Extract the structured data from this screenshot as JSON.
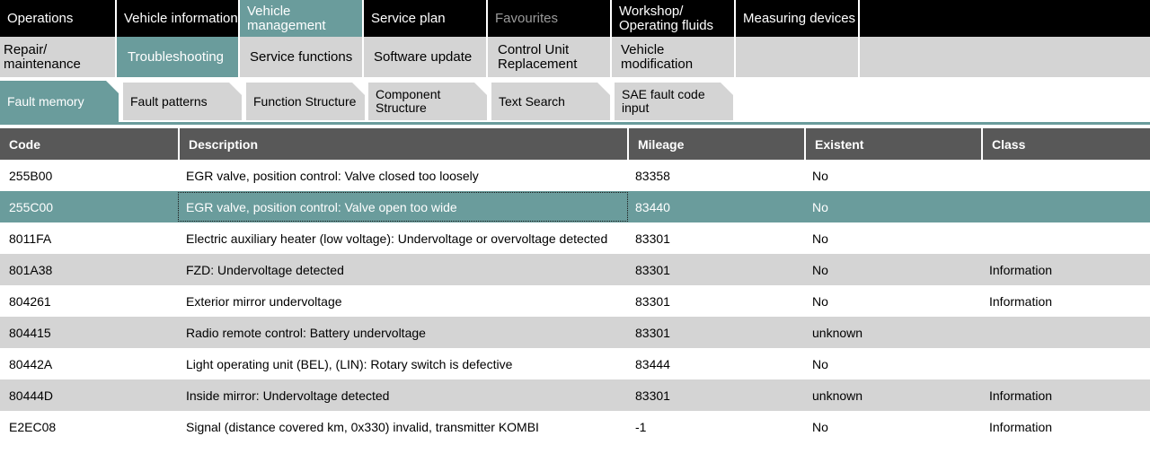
{
  "main_tabs": [
    {
      "label": "Operations",
      "state": "normal"
    },
    {
      "label": "Vehicle information",
      "state": "normal"
    },
    {
      "label": "Vehicle management",
      "state": "active"
    },
    {
      "label": "Service plan",
      "state": "normal"
    },
    {
      "label": "Favourites",
      "state": "disabled"
    },
    {
      "label": "Workshop/ Operating fluids",
      "state": "normal"
    },
    {
      "label": "Measuring devices",
      "state": "normal"
    }
  ],
  "sub_tabs": [
    {
      "label": "Repair/ maintenance",
      "state": "normal"
    },
    {
      "label": "Troubleshooting",
      "state": "active"
    },
    {
      "label": "Service functions",
      "state": "normal"
    },
    {
      "label": "Software update",
      "state": "normal"
    },
    {
      "label": "Control Unit Replacement",
      "state": "normal"
    },
    {
      "label": "Vehicle modification",
      "state": "normal"
    }
  ],
  "function_tabs": [
    {
      "label": "Fault memory",
      "state": "active"
    },
    {
      "label": "Fault patterns",
      "state": "normal"
    },
    {
      "label": "Function Structure",
      "state": "normal"
    },
    {
      "label": "Component Structure",
      "state": "normal"
    },
    {
      "label": "Text Search",
      "state": "normal"
    },
    {
      "label": "SAE fault code input",
      "state": "normal"
    }
  ],
  "table": {
    "headers": {
      "code": "Code",
      "description": "Description",
      "mileage": "Mileage",
      "existent": "Existent",
      "class": "Class"
    },
    "rows": [
      {
        "code": "255B00",
        "description": "EGR valve, position control: Valve closed too loosely",
        "mileage": "83358",
        "existent": "No",
        "class": ""
      },
      {
        "code": "255C00",
        "description": "EGR valve, position control: Valve open too wide",
        "mileage": "83440",
        "existent": "No",
        "class": ""
      },
      {
        "code": "8011FA",
        "description": "Electric auxiliary heater (low voltage): Undervoltage or overvoltage detected",
        "mileage": "83301",
        "existent": "No",
        "class": ""
      },
      {
        "code": "801A38",
        "description": "FZD: Undervoltage detected",
        "mileage": "83301",
        "existent": "No",
        "class": "Information"
      },
      {
        "code": "804261",
        "description": "Exterior mirror undervoltage",
        "mileage": "83301",
        "existent": "No",
        "class": "Information"
      },
      {
        "code": "804415",
        "description": "Radio remote control: Battery undervoltage",
        "mileage": "83301",
        "existent": "unknown",
        "class": ""
      },
      {
        "code": "80442A",
        "description": "Light operating unit (BEL), (LIN): Rotary switch is defective",
        "mileage": "83444",
        "existent": "No",
        "class": ""
      },
      {
        "code": "80444D",
        "description": "Inside mirror: Undervoltage detected",
        "mileage": "83301",
        "existent": "unknown",
        "class": "Information"
      },
      {
        "code": "E2EC08",
        "description": "Signal (distance covered km, 0x330) invalid, transmitter KOMBI",
        "mileage": "-1",
        "existent": "No",
        "class": "Information"
      }
    ],
    "selected_row_code": "255C00"
  },
  "colors": {
    "accent": "#6a9c9c",
    "header_bg": "#585858",
    "alt_row_bg": "#d4d4d4",
    "tab_bar_bg": "#000000"
  }
}
